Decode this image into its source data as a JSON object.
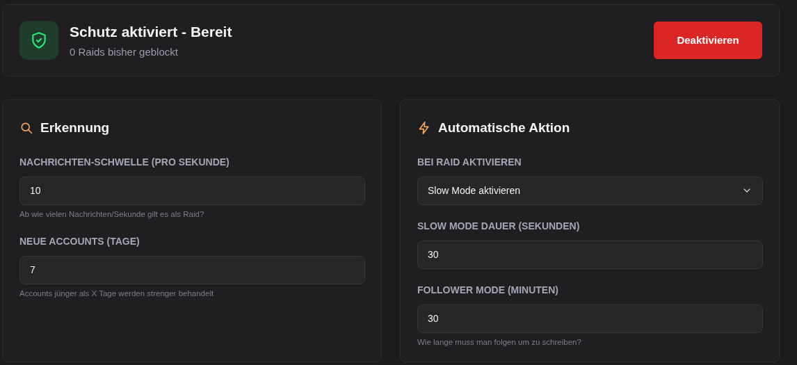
{
  "status": {
    "title": "Schutz aktiviert - Bereit",
    "subtitle": "0 Raids bisher geblockt",
    "button": "Deaktivieren"
  },
  "panels": [
    {
      "kind": "detection",
      "title": "Erkennung",
      "fields": [
        {
          "kind": "input",
          "label": "NACHRICHTEN-SCHWELLE (PRO SEKUNDE)",
          "value": "10",
          "hint": "Ab wie vielen Nachrichten/Sekunde gilt es als Raid?"
        },
        {
          "kind": "input",
          "label": "NEUE ACCOUNTS (TAGE)",
          "value": "7",
          "hint": "Accounts jünger als X Tage werden strenger behandelt"
        }
      ]
    },
    {
      "kind": "action",
      "title": "Automatische Aktion",
      "fields": [
        {
          "kind": "select",
          "label": "BEI RAID AKTIVIEREN",
          "value": "Slow Mode aktivieren"
        },
        {
          "kind": "input",
          "label": "SLOW MODE DAUER (SEKUNDEN)",
          "value": "30"
        },
        {
          "kind": "input",
          "label": "FOLLOWER MODE (MINUTEN)",
          "value": "30",
          "hint": "Wie lange muss man folgen um zu schreiben?"
        }
      ]
    }
  ]
}
